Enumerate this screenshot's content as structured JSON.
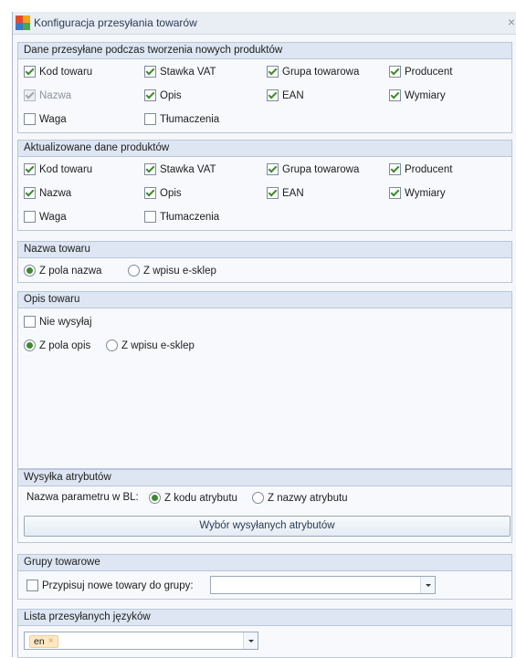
{
  "window": {
    "title": "Konfiguracja przesyłania towarów",
    "close": "×"
  },
  "section_new": {
    "header": "Dane przesyłane podczas tworzenia nowych produktów",
    "items": [
      {
        "label": "Kod towaru",
        "checked": true,
        "disabled": false
      },
      {
        "label": "Stawka VAT",
        "checked": true,
        "disabled": false
      },
      {
        "label": "Grupa towarowa",
        "checked": true,
        "disabled": false
      },
      {
        "label": "Producent",
        "checked": true,
        "disabled": false
      },
      {
        "label": "Nazwa",
        "checked": true,
        "disabled": true
      },
      {
        "label": "Opis",
        "checked": true,
        "disabled": false
      },
      {
        "label": "EAN",
        "checked": true,
        "disabled": false
      },
      {
        "label": "Wymiary",
        "checked": true,
        "disabled": false
      },
      {
        "label": "Waga",
        "checked": false,
        "disabled": false
      },
      {
        "label": "Tłumaczenia",
        "checked": false,
        "disabled": false
      }
    ]
  },
  "section_update": {
    "header": "Aktualizowane dane produktów",
    "items": [
      {
        "label": "Kod towaru",
        "checked": true
      },
      {
        "label": "Stawka VAT",
        "checked": true
      },
      {
        "label": "Grupa towarowa",
        "checked": true
      },
      {
        "label": "Producent",
        "checked": true
      },
      {
        "label": "Nazwa",
        "checked": true
      },
      {
        "label": "Opis",
        "checked": true
      },
      {
        "label": "EAN",
        "checked": true
      },
      {
        "label": "Wymiary",
        "checked": true
      },
      {
        "label": "Waga",
        "checked": false
      },
      {
        "label": "Tłumaczenia",
        "checked": false
      }
    ]
  },
  "section_name": {
    "header": "Nazwa towaru",
    "options": [
      "Z pola nazwa",
      "Z wpisu e-sklep"
    ],
    "selected": 0
  },
  "section_desc": {
    "header": "Opis towaru",
    "dont_send": "Nie wysyłaj",
    "dont_send_checked": false,
    "options": [
      "Z pola opis",
      "Z wpisu e-sklep"
    ],
    "selected": 0
  },
  "section_attr": {
    "header": "Wysyłka atrybutów",
    "param_label": "Nazwa parametru w BL:",
    "options": [
      "Z kodu atrybutu",
      "Z nazwy atrybutu"
    ],
    "selected": 0,
    "button": "Wybór wysyłanych atrybutów"
  },
  "section_groups": {
    "header": "Grupy towarowe",
    "assign_label": "Przypisuj nowe towary do grupy:",
    "assign_checked": false,
    "group_value": ""
  },
  "section_langs": {
    "header": "Lista przesyłanych języków",
    "tags": [
      "en"
    ],
    "tag_remove": "×"
  },
  "colors": {
    "check": "#3d8a2e",
    "header_bg": "#dde6f2",
    "border": "#b9c7da"
  }
}
